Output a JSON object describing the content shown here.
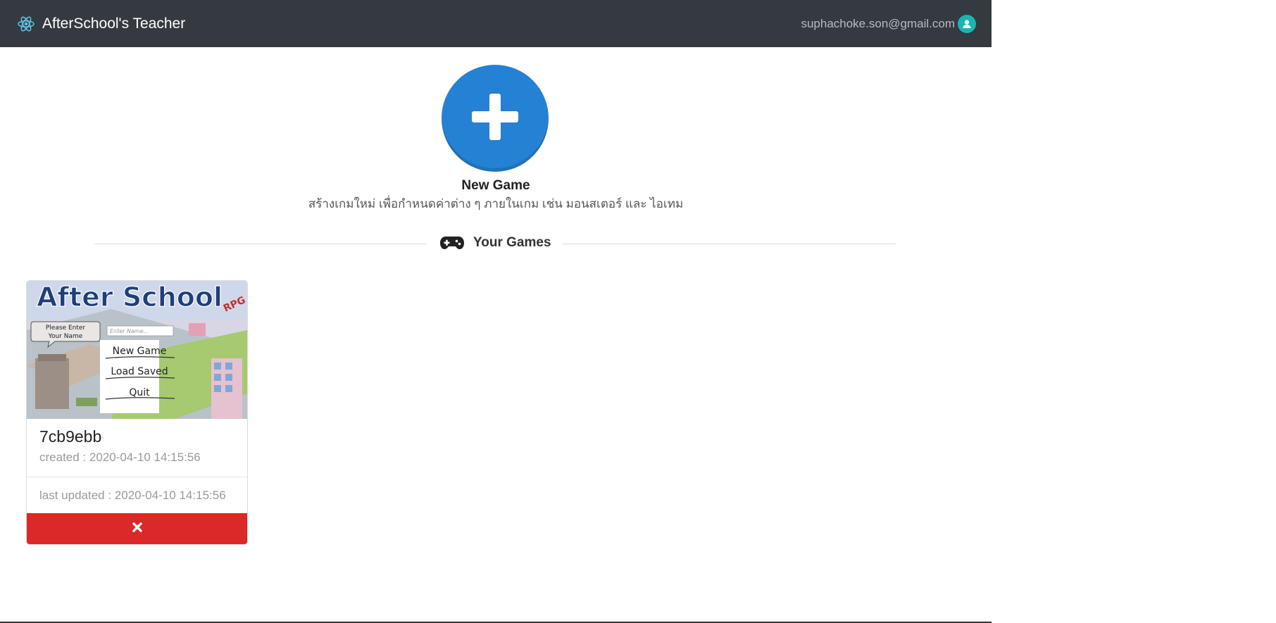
{
  "app": {
    "title": "AfterSchool's Teacher",
    "logo_icon": "react-atom-icon"
  },
  "user": {
    "email": "suphachoke.son@gmail.com",
    "avatar_icon": "user-icon"
  },
  "new_game": {
    "button_icon": "plus-icon",
    "title": "New Game",
    "description": "สร้างเกมใหม่ เพื่อกำหนดค่าต่าง ๆ ภายในเกม เช่น มอนสเตอร์ และ ไอเทม"
  },
  "section": {
    "title": "Your Games",
    "icon": "gamepad-icon"
  },
  "games": [
    {
      "id": "7cb9ebb",
      "created": "created : 2020-04-10 14:15:56",
      "last_updated": "last updated : 2020-04-10 14:15:56",
      "thumbnail": {
        "title": "After School",
        "tag": "RPG",
        "prompt_line1": "Please Enter",
        "prompt_line2": "Your Name",
        "name_placeholder": "Enter Name...",
        "menu": [
          "New Game",
          "Load Saved",
          "Quit"
        ]
      },
      "delete_icon": "close-icon"
    }
  ],
  "colors": {
    "navbar": "#343a40",
    "accent_blue": "#2481d4",
    "avatar_teal": "#1ab5b1",
    "danger_red": "#db2828"
  }
}
